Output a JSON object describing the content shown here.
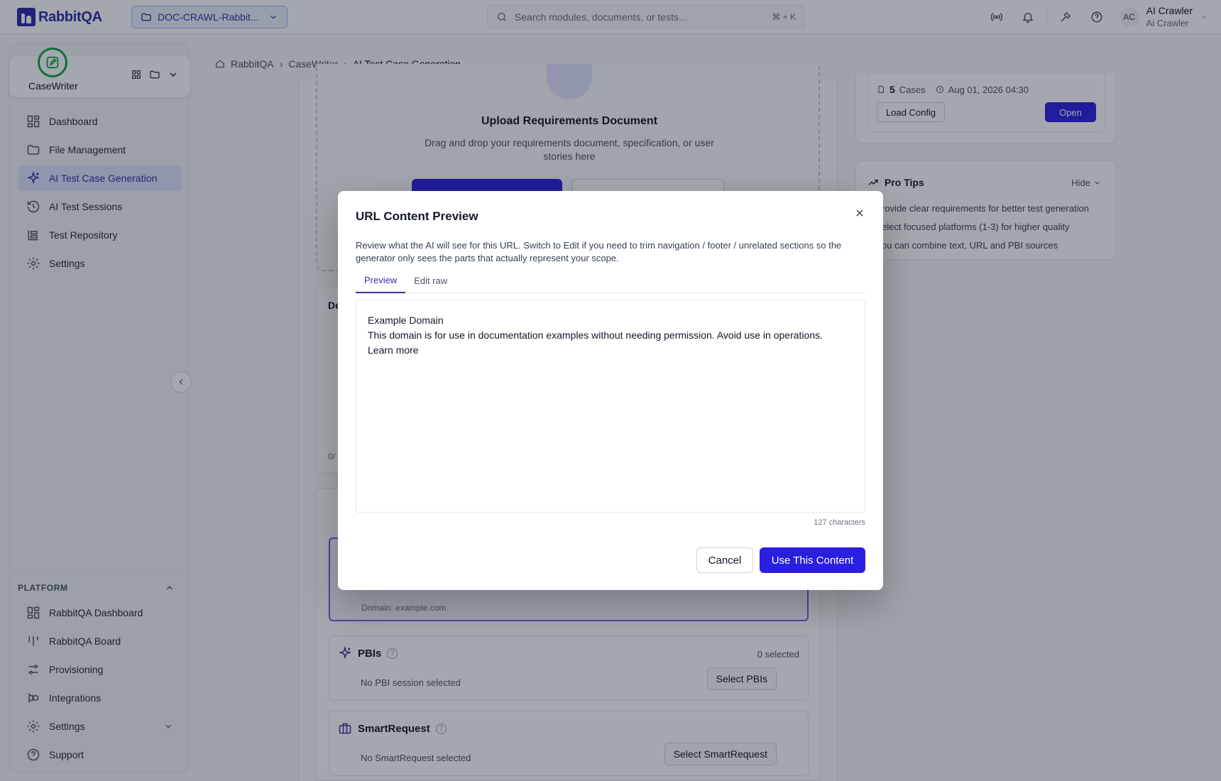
{
  "app": {
    "logo_text": "RabbitQA",
    "project": "DOC-CRAWL-Rabbit...",
    "search_placeholder": "Search modules, documents, or tests...",
    "search_shortcut": "⌘ + K",
    "user": {
      "initials": "AC",
      "name": "AI Crawler",
      "subtitle": "Ai Crawler"
    }
  },
  "sidebar": {
    "app_name": "CaseWriter",
    "items": [
      {
        "label": "Dashboard",
        "icon": "dashboard-icon"
      },
      {
        "label": "File Management",
        "icon": "folder-icon"
      },
      {
        "label": "AI Test Case Generation",
        "icon": "sparkle-icon",
        "active": true
      },
      {
        "label": "AI Test Sessions",
        "icon": "history-icon"
      },
      {
        "label": "Test Repository",
        "icon": "repository-icon"
      },
      {
        "label": "Settings",
        "icon": "gear-icon"
      }
    ],
    "platform_heading": "PLATFORM",
    "platform_items": [
      {
        "label": "RabbitQA Dashboard",
        "icon": "dashboard-icon"
      },
      {
        "label": "RabbitQA Board",
        "icon": "board-icon"
      },
      {
        "label": "Provisioning",
        "icon": "sliders-icon"
      },
      {
        "label": "Integrations",
        "icon": "integrations-icon"
      },
      {
        "label": "Settings",
        "icon": "gear-icon"
      },
      {
        "label": "Support",
        "icon": "help-icon"
      }
    ]
  },
  "breadcrumb": [
    "RabbitQA",
    "CaseWriter",
    "AI Test Case Generation"
  ],
  "main": {
    "upload_title": "Upload Requirements Document",
    "upload_desc": "Drag and drop your requirements document, specification, or user stories here",
    "panel_head": "De",
    "panel_foot": "0/",
    "url_domain": "Domain: example.com",
    "pbis": {
      "title": "PBIs",
      "count": "0 selected",
      "empty": "No PBI session selected",
      "button": "Select PBIs"
    },
    "smartrequest": {
      "title": "SmartRequest",
      "empty": "No SmartRequest selected",
      "button": "Select SmartRequest"
    }
  },
  "right": {
    "cases_count": "5",
    "cases_label": "Cases",
    "date": "Aug 01, 2026 04:30",
    "load_config": "Load Config",
    "open": "Open",
    "tips_title": "Pro Tips",
    "tips_hide": "Hide",
    "tips": [
      "rovide clear requirements for better test generation",
      "elect focused platforms (1-3) for higher quality",
      "ou can combine text, URL and PBI sources"
    ]
  },
  "modal": {
    "title": "URL Content Preview",
    "description": "Review what the AI will see for this URL. Switch to Edit if you need to trim navigation / footer / unrelated sections so the generator only sees the parts that actually represent your scope.",
    "tabs": [
      "Preview",
      "Edit raw"
    ],
    "content_lines": [
      "Example Domain",
      "This domain is for use in documentation examples without needing permission. Avoid use in operations.",
      "Learn more"
    ],
    "char_count": "127 characters",
    "cancel": "Cancel",
    "confirm": "Use This Content"
  }
}
